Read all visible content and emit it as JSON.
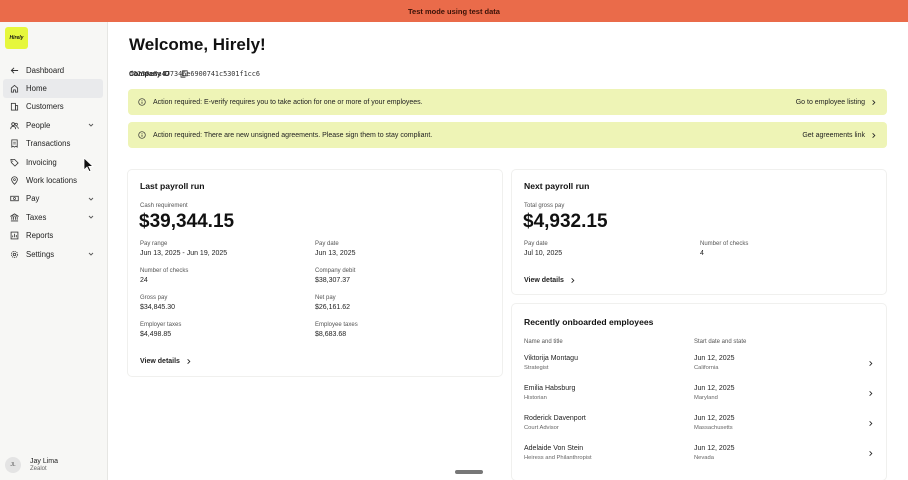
{
  "banner": {
    "text": "Test mode using test data"
  },
  "brand": {
    "logo_text": "Hirely"
  },
  "sidebar": {
    "items": [
      {
        "label": "Dashboard",
        "icon": "arrow-left-icon"
      },
      {
        "label": "Home",
        "icon": "home-icon",
        "active": true
      },
      {
        "label": "Customers",
        "icon": "building-icon"
      },
      {
        "label": "People",
        "icon": "people-icon",
        "expandable": true
      },
      {
        "label": "Transactions",
        "icon": "receipt-icon"
      },
      {
        "label": "Invoicing",
        "icon": "tag-icon"
      },
      {
        "label": "Work locations",
        "icon": "pin-icon"
      },
      {
        "label": "Pay",
        "icon": "money-icon",
        "expandable": true
      },
      {
        "label": "Taxes",
        "icon": "bank-icon",
        "expandable": true
      },
      {
        "label": "Reports",
        "icon": "chart-icon"
      },
      {
        "label": "Settings",
        "icon": "gear-icon",
        "expandable": true
      }
    ]
  },
  "user": {
    "initials": "JL",
    "name": "Jay Lima",
    "role": "Zealot"
  },
  "header": {
    "title": "Welcome, Hirely!",
    "company_id_label": "Company ID",
    "company_id": "d0230e8a477346e6900741c5301f1cc6"
  },
  "alerts": [
    {
      "text": "Action required: E-verify requires you to take action for one or more of your employees.",
      "action": "Go to employee listing"
    },
    {
      "text": "Action required: There are new unsigned agreements. Please sign them to stay compliant.",
      "action": "Get agreements link"
    }
  ],
  "last_payroll": {
    "title": "Last payroll run",
    "cash_label": "Cash requirement",
    "cash_value": "$39,344.15",
    "pay_range_label": "Pay range",
    "pay_range": "Jun 13, 2025 - Jun 19, 2025",
    "pay_date_label": "Pay date",
    "pay_date": "Jun 13, 2025",
    "checks_label": "Number of checks",
    "checks": "24",
    "debit_label": "Company debit",
    "debit": "$38,307.37",
    "gross_label": "Gross pay",
    "gross": "$34,845.30",
    "net_label": "Net pay",
    "net": "$26,161.62",
    "employer_taxes_label": "Employer taxes",
    "employer_taxes": "$4,498.85",
    "employee_taxes_label": "Employee taxes",
    "employee_taxes": "$8,683.68",
    "view_details": "View details"
  },
  "next_payroll": {
    "title": "Next payroll run",
    "gross_label": "Total gross pay",
    "gross_value": "$4,932.15",
    "pay_date_label": "Pay date",
    "pay_date": "Jul 10, 2025",
    "checks_label": "Number of checks",
    "checks": "4",
    "view_details": "View details"
  },
  "onboarded": {
    "title": "Recently onboarded employees",
    "col_name": "Name and title",
    "col_start": "Start date and state",
    "rows": [
      {
        "name": "Viktorija Montagu",
        "title": "Strategist",
        "date": "Jun 12, 2025",
        "state": "California"
      },
      {
        "name": "Emilia Habsburg",
        "title": "Historian",
        "date": "Jun 12, 2025",
        "state": "Maryland"
      },
      {
        "name": "Roderick Davenport",
        "title": "Court Advisor",
        "date": "Jun 12, 2025",
        "state": "Massachusetts"
      },
      {
        "name": "Adelaide Von Stein",
        "title": "Heiress and Philanthropist",
        "date": "Jun 12, 2025",
        "state": "Nevada"
      }
    ]
  }
}
